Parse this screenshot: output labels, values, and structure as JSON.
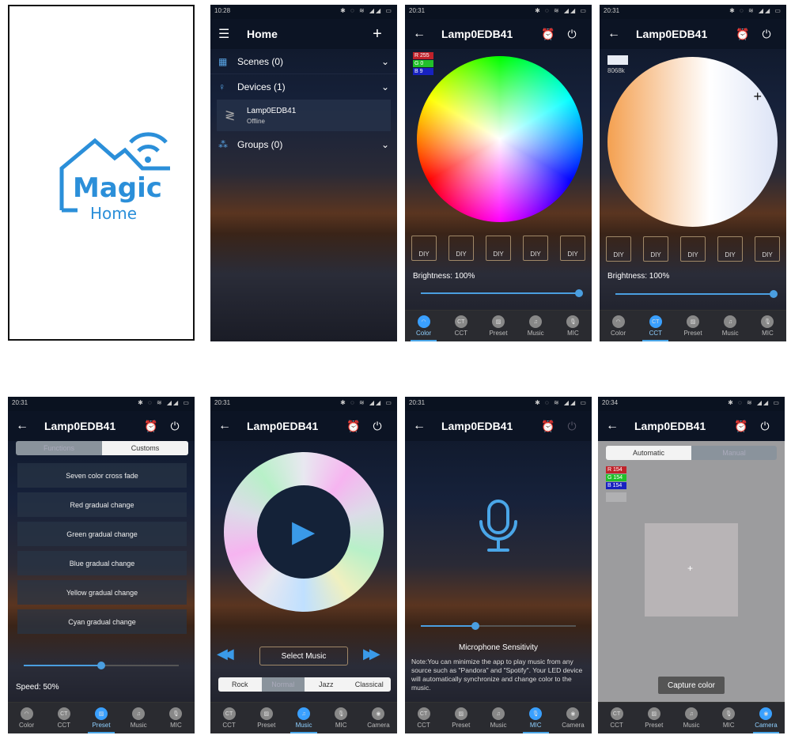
{
  "splash": {
    "logo_word1": "Magic",
    "logo_word2": "Home",
    "logo_color": "#2b8fd9"
  },
  "home": {
    "time": "10:28",
    "title": "Home",
    "add": "+",
    "sections": [
      {
        "label": "Scenes (0)"
      },
      {
        "label": "Devices (1)"
      },
      {
        "label": "Groups (0)"
      }
    ],
    "device": {
      "name": "Lamp0EDB41",
      "status": "Offline"
    }
  },
  "device_name": "Lamp0EDB41",
  "color_screen": {
    "time": "20:31",
    "rgb": {
      "r": "R 255",
      "g": "G 0",
      "b": "B 9"
    },
    "diy": [
      "DIY",
      "DIY",
      "DIY",
      "DIY",
      "DIY"
    ],
    "brightness_label": "Brightness: 100%",
    "brightness": 1.0
  },
  "cct_screen": {
    "time": "20:31",
    "kelvin": "8068k",
    "diy": [
      "DIY",
      "DIY",
      "DIY",
      "DIY",
      "DIY"
    ],
    "brightness_label": "Brightness: 100%",
    "brightness": 1.0
  },
  "preset_screen": {
    "time": "20:31",
    "tabs": [
      "Functions",
      "Customs"
    ],
    "items": [
      "Seven color cross fade",
      "Red gradual change",
      "Green gradual change",
      "Blue gradual change",
      "Yellow gradual change",
      "Cyan gradual change"
    ],
    "speed_label": "Speed: 50%",
    "speed": 0.5
  },
  "music_screen": {
    "time": "20:31",
    "select": "Select Music",
    "genres": [
      "Rock",
      "Normal",
      "Jazz",
      "Classical"
    ],
    "selected_genre": "Normal"
  },
  "mic_screen": {
    "time": "20:31",
    "sensitivity_label": "Microphone Sensitivity",
    "sensitivity": 0.35,
    "note": "Note:You can minimize the app to play music from any source such as \"Pandora\" and \"Spotify\". Your LED device will automatically synchronize and change color to the music."
  },
  "camera_screen": {
    "time": "20:34",
    "tabs": [
      "Automatic",
      "Manual"
    ],
    "rgb": {
      "r": "R 154",
      "g": "G 154",
      "b": "B 154"
    },
    "capture": "Capture color"
  },
  "tabs_a": [
    {
      "label": "Color",
      "glyph": "◠"
    },
    {
      "label": "CCT",
      "glyph": "CT"
    },
    {
      "label": "Preset",
      "glyph": "▨"
    },
    {
      "label": "Music",
      "glyph": "♫"
    },
    {
      "label": "MIC",
      "glyph": "🎙"
    }
  ],
  "tabs_b": [
    {
      "label": "CCT",
      "glyph": "CT"
    },
    {
      "label": "Preset",
      "glyph": "▨"
    },
    {
      "label": "Music",
      "glyph": "♫"
    },
    {
      "label": "MIC",
      "glyph": "🎙"
    },
    {
      "label": "Camera",
      "glyph": "◉"
    }
  ],
  "icons": {
    "back": "←",
    "alarm": "⏰",
    "power": "⏻",
    "menu": "☰",
    "chevron": "⌄",
    "rewind": "◀◀",
    "forward": "▶▶",
    "play": "▶"
  }
}
